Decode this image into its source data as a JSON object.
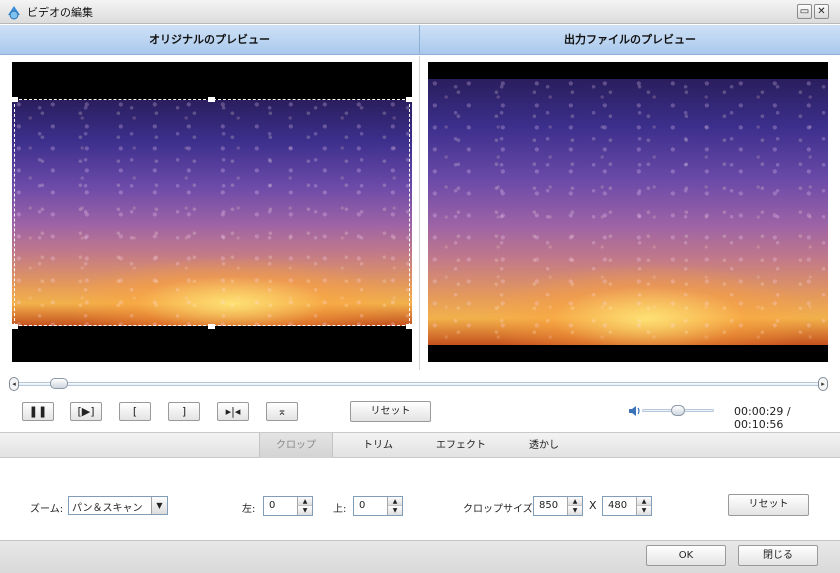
{
  "window": {
    "title": "ビデオの編集",
    "minimize_glyph": "▭",
    "close_glyph": "✕"
  },
  "preview": {
    "original_label": "オリジナルのプレビュー",
    "output_label": "出力ファイルのプレビュー"
  },
  "playback": {
    "pause_glyph": "❚❚",
    "play_segment_glyph": "[▶]",
    "mark_in_glyph": "[",
    "mark_out_glyph": "]",
    "split_glyph": "▸|◂",
    "fit_glyph": "⌅",
    "reset_label": "リセット",
    "current_time": "00:00:29",
    "total_time": "00:10:56",
    "time_separator": " / ",
    "volume_fraction": 0.45,
    "position_fraction": 0.044
  },
  "tabs": [
    {
      "label": "クロップ",
      "active": true
    },
    {
      "label": "トリム",
      "active": false
    },
    {
      "label": "エフェクト",
      "active": false
    },
    {
      "label": "透かし",
      "active": false
    }
  ],
  "crop": {
    "zoom_label": "ズーム:",
    "zoom_value": "パン＆スキャン",
    "left_label": "左:",
    "left_value": "0",
    "top_label": "上:",
    "top_value": "0",
    "size_label": "クロップサイズ:",
    "width_value": "850",
    "times_label": "X",
    "height_value": "480",
    "reset_label": "リセット"
  },
  "footer": {
    "ok_label": "OK",
    "close_label": "閉じる"
  },
  "colors": {
    "header_blue": "#b9d3f0",
    "frame_black": "#000000"
  }
}
